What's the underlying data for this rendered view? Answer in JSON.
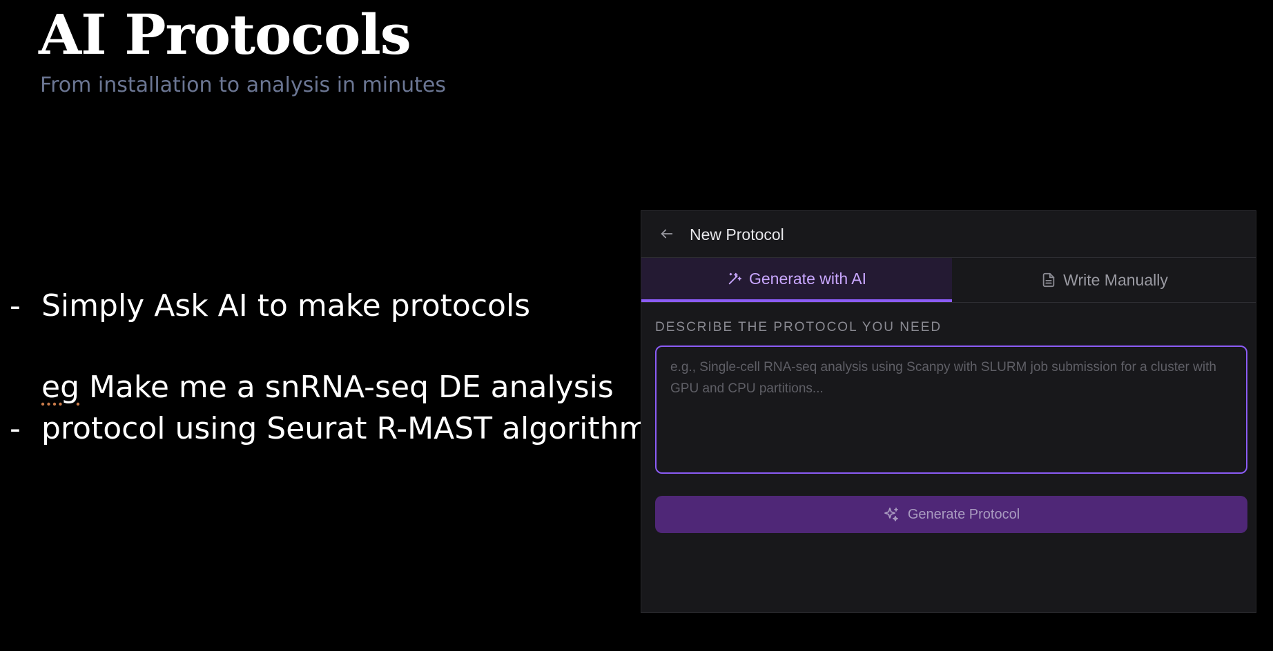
{
  "slide": {
    "title": "AI Protocols",
    "subtitle": "From installation to analysis in minutes",
    "bullets": [
      {
        "marker": "-",
        "text": "Simply Ask AI to make protocols"
      },
      {
        "marker": "-",
        "lines": [
          "eg Make me a snRNA-seq DE analysis",
          "protocol using Seurat R-MAST algorithm"
        ]
      }
    ]
  },
  "panel": {
    "back_icon": "arrow-left-icon",
    "title": "New Protocol",
    "tabs": [
      {
        "label": "Generate with AI",
        "icon": "magic-wand-icon",
        "active": true
      },
      {
        "label": "Write Manually",
        "icon": "document-icon",
        "active": false
      }
    ],
    "field_label": "DESCRIBE THE PROTOCOL YOU NEED",
    "prompt": {
      "value": "",
      "placeholder": "e.g., Single-cell RNA-seq analysis using Scanpy with SLURM job submission for a cluster with GPU and CPU partitions..."
    },
    "generate_button": {
      "label": "Generate Protocol",
      "icon": "sparkles-icon"
    }
  },
  "colors": {
    "accent": "#8b5cf6",
    "active_tab_bg": "#241a33",
    "button_bg": "#4f2777",
    "panel_bg": "#18181b",
    "subtitle": "#6b7693"
  }
}
